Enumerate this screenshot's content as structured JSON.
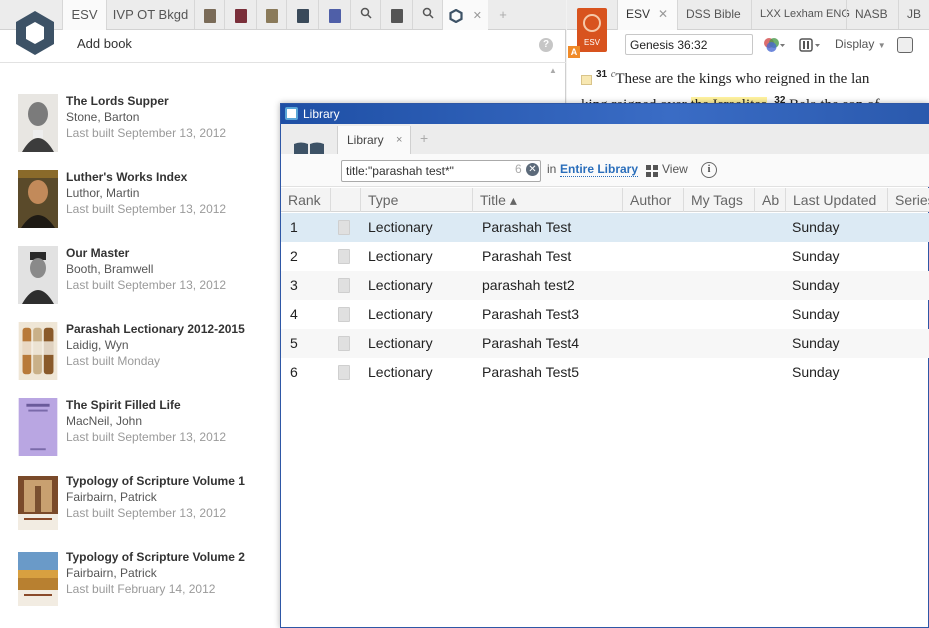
{
  "left_panel": {
    "tabs": [
      {
        "label": "ESV"
      },
      {
        "label": "IVP OT Bkgd"
      }
    ],
    "add_book_label": "Add book",
    "help_label": "?",
    "books": [
      {
        "title": "The Lords Supper",
        "author": "Stone, Barton",
        "built": "Last built September 13, 2012"
      },
      {
        "title": "Luther's Works Index",
        "author": "Luthor, Martin",
        "built": "Last built September 13, 2012"
      },
      {
        "title": "Our Master",
        "author": "Booth, Bramwell",
        "built": "Last built September 13, 2012"
      },
      {
        "title": "Parashah Lectionary 2012-2015",
        "author": "Laidig, Wyn",
        "built": "Last built Monday"
      },
      {
        "title": "The Spirit Filled Life",
        "author": "MacNeil, John",
        "built": "Last built September 13, 2012"
      },
      {
        "title": "Typology of Scripture Volume 1",
        "author": "Fairbairn, Patrick",
        "built": "Last built September 13, 2012"
      },
      {
        "title": "Typology of Scripture Volume 2",
        "author": "Fairbairn, Patrick",
        "built": "Last built February 14, 2012"
      }
    ]
  },
  "right_panel": {
    "tabs": [
      {
        "label": "ESV"
      },
      {
        "label": "DSS Bible"
      },
      {
        "label": "LXX Lexham ENG"
      },
      {
        "label": "NASB"
      },
      {
        "label": "JB"
      }
    ],
    "esv_cover_label": "ESV",
    "esv_badge": "A",
    "reference": "Genesis 36:32",
    "display_label": "Display",
    "text": {
      "v31_num": "31",
      "v31_fn": "c",
      "v31_text": "These are the kings who reigned in the lan",
      "line2_pre": "king reigned over ",
      "line2_hl": "the Israelites",
      "line2_post": ".",
      "v32_num": "32",
      "v32_text": "Bela the son of"
    }
  },
  "library": {
    "window_title": "Library",
    "tab_label": "Library",
    "tab_close": "×",
    "new_tab": "+",
    "search_value": "title:\"parashah test*\"",
    "result_count": "6",
    "in_label": "in",
    "scope_label": "Entire Library",
    "view_label": "View",
    "info_label": "i",
    "columns": [
      "Rank",
      "",
      "Type",
      "Title ▴",
      "Author",
      "My Tags",
      "Ab",
      "Last Updated",
      "Series"
    ],
    "rows": [
      {
        "rank": "1",
        "type": "Lectionary",
        "title": "Parashah Test",
        "updated": "Sunday"
      },
      {
        "rank": "2",
        "type": "Lectionary",
        "title": "Parashah Test",
        "updated": "Sunday"
      },
      {
        "rank": "3",
        "type": "Lectionary",
        "title": "parashah test2",
        "updated": "Sunday"
      },
      {
        "rank": "4",
        "type": "Lectionary",
        "title": "Parashah Test3",
        "updated": "Sunday"
      },
      {
        "rank": "5",
        "type": "Lectionary",
        "title": "Parashah Test4",
        "updated": "Sunday"
      },
      {
        "rank": "6",
        "type": "Lectionary",
        "title": "Parashah Test5",
        "updated": "Sunday"
      }
    ]
  },
  "colors": {
    "accent_blue": "#2a6ebb",
    "title_bar": "#1e4fa5",
    "selected_row": "#dceaf4",
    "highlight": "#fff29e",
    "esv_orange": "#d8531e"
  }
}
